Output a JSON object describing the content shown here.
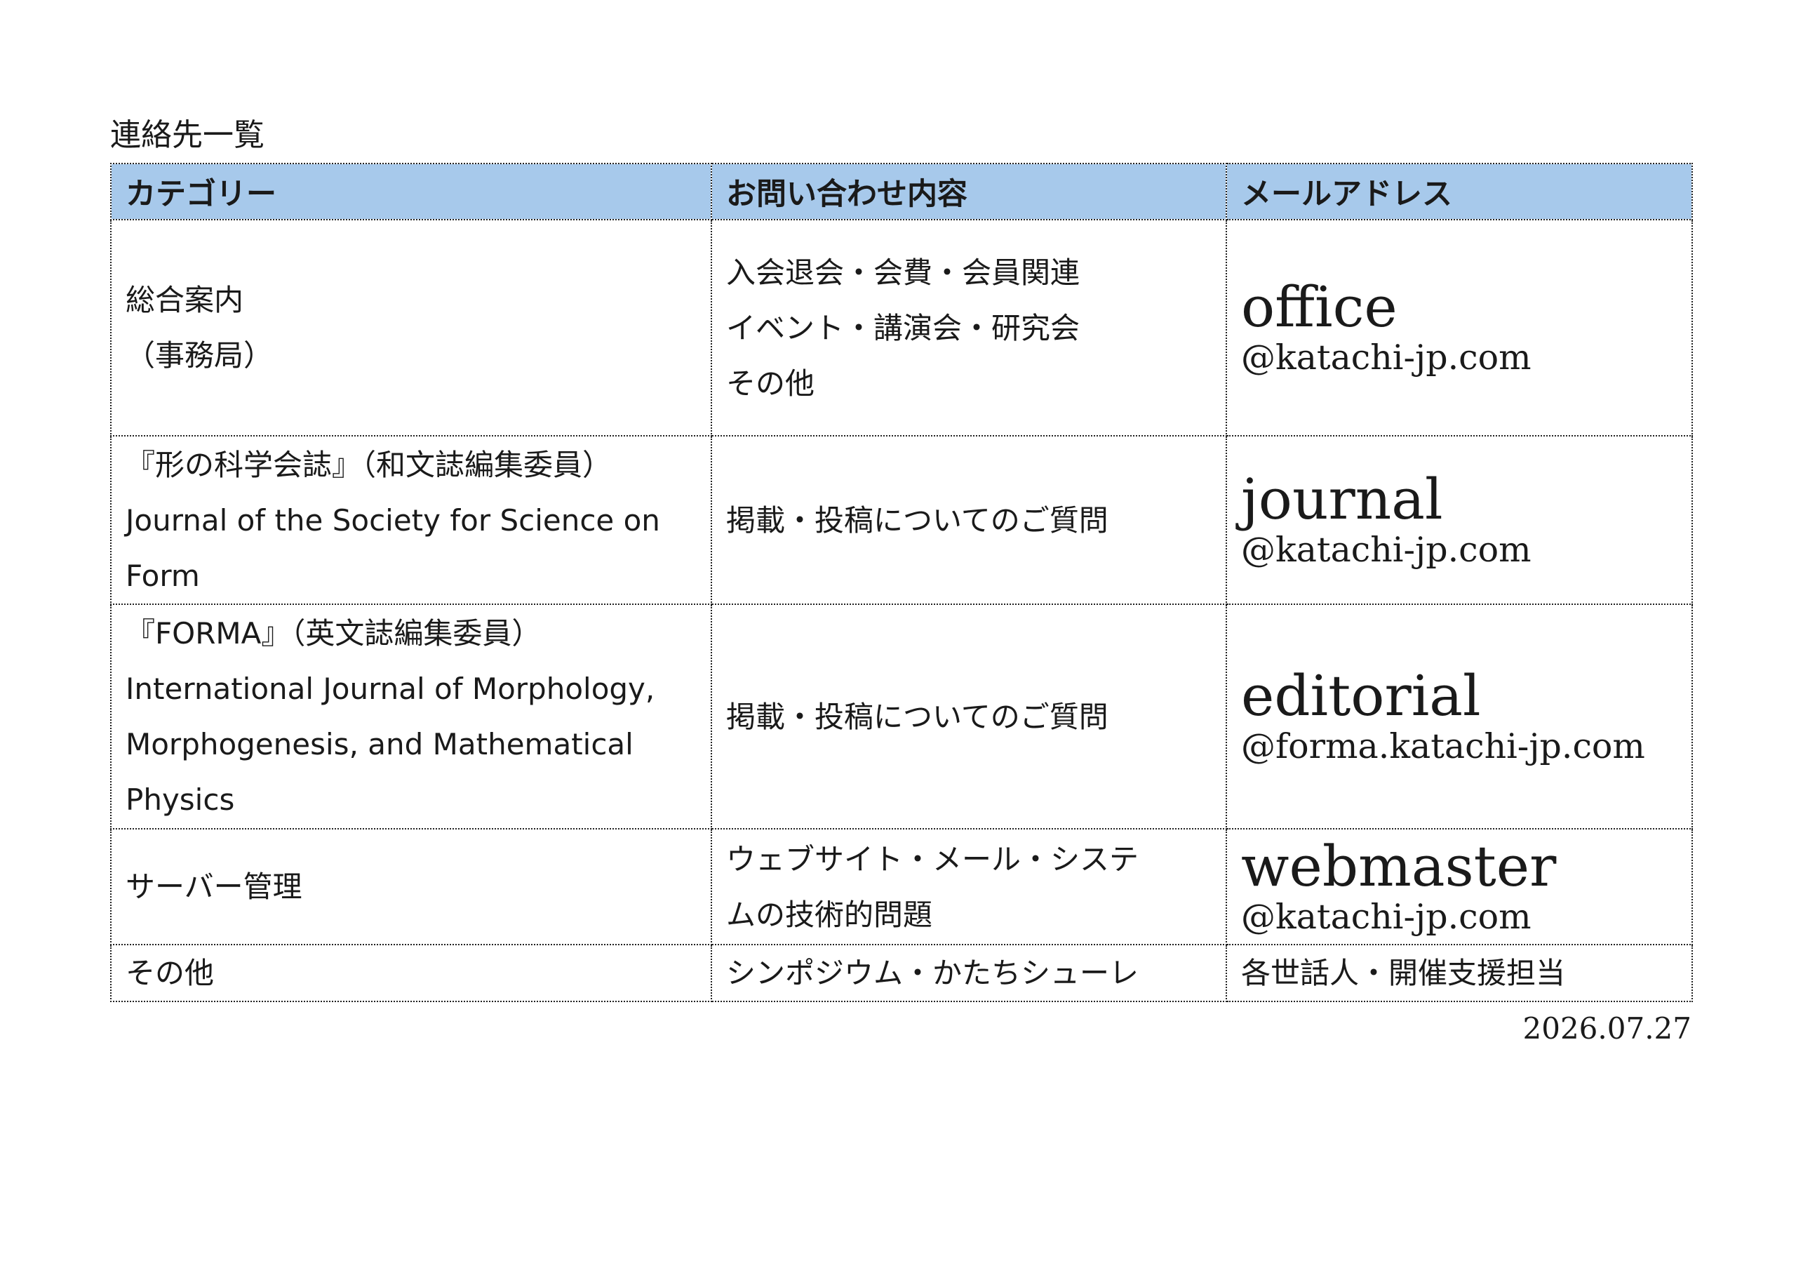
{
  "title": "連絡先一覧",
  "headers": {
    "category": "カテゴリー",
    "inquiry": "お問い合わせ内容",
    "email": "メールアドレス"
  },
  "rows": [
    {
      "category_lines": [
        "総合案内",
        "（事務局）"
      ],
      "inquiry_lines": [
        "入会退会・会費・会員関連",
        "イベント・講演会・研究会",
        "その他"
      ],
      "email_user": "office",
      "email_domain": "@katachi-jp.com"
    },
    {
      "category_lines": [
        "『形の科学会誌』（和文誌編集委員）",
        "Journal of the Society for Science on",
        "Form"
      ],
      "inquiry_lines": [
        "掲載・投稿についてのご質問"
      ],
      "email_user": "journal",
      "email_domain": "@katachi-jp.com"
    },
    {
      "category_lines": [
        "『FORMA』（英文誌編集委員）",
        "International Journal of Morphology,",
        "Morphogenesis, and Mathematical",
        "Physics"
      ],
      "inquiry_lines": [
        "掲載・投稿についてのご質問"
      ],
      "email_user": "editorial",
      "email_domain": "@forma.katachi-jp.com"
    },
    {
      "category_lines": [
        "サーバー管理"
      ],
      "inquiry_lines": [
        "ウェブサイト・メール・システ",
        "ムの技術的問題"
      ],
      "email_user": "webmaster",
      "email_domain": "@katachi-jp.com"
    },
    {
      "category_lines": [
        "その他"
      ],
      "inquiry_lines": [
        "シンポジウム・かたちシューレ"
      ],
      "email_text": "各世話人・開催支援担当"
    }
  ],
  "date": "2026.07.27"
}
